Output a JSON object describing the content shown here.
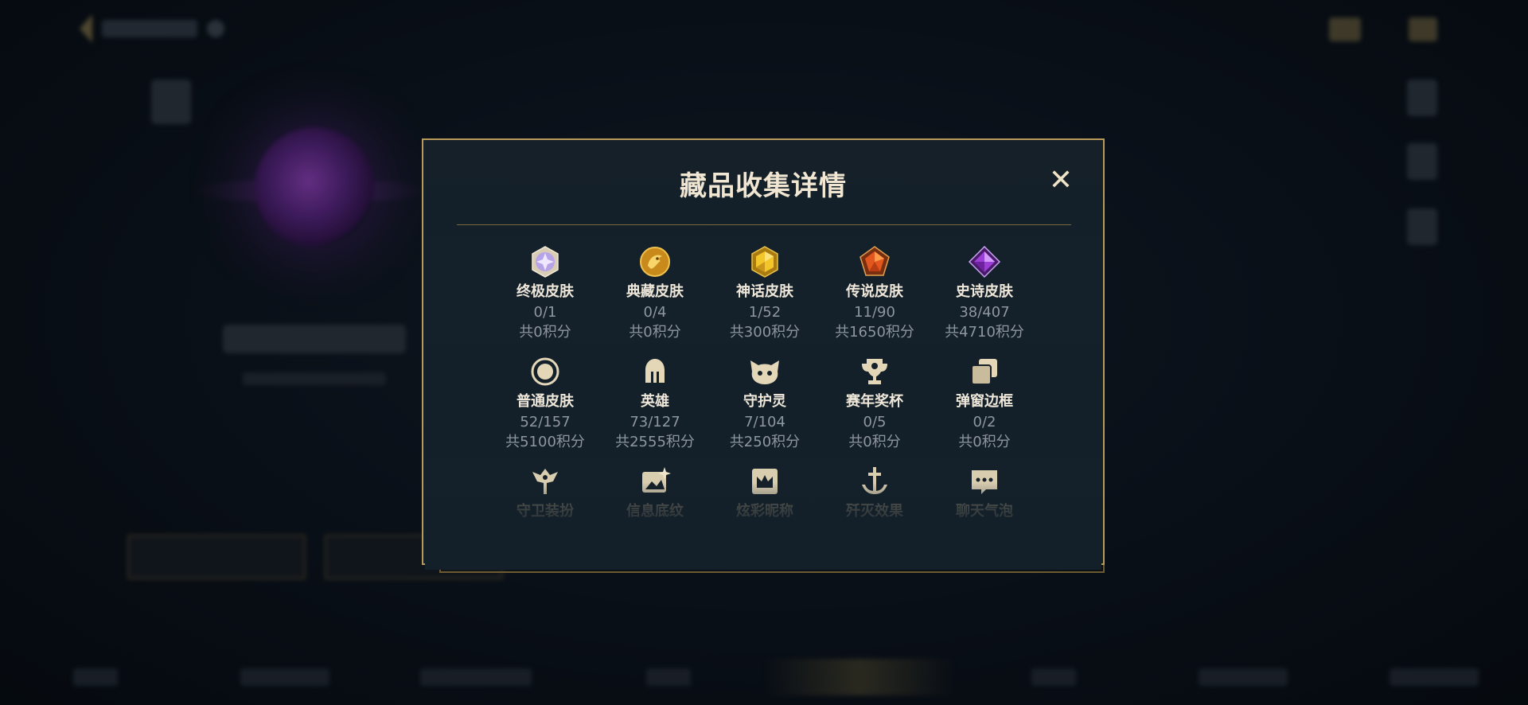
{
  "dialog": {
    "title": "藏品收集详情",
    "close_symbol": "✕"
  },
  "colors": {
    "accent_gold": "#b89b5a",
    "dialog_bg": "#152029",
    "title_text": "#f0e6d2",
    "secondary_text": "#8f969f"
  },
  "rows": [
    [
      {
        "label": "终极皮肤",
        "count": "0/1",
        "points": "共0积分",
        "icon": "ultimate-gem-icon"
      },
      {
        "label": "典藏皮肤",
        "count": "0/4",
        "points": "共0积分",
        "icon": "prestige-dragon-icon"
      },
      {
        "label": "神话皮肤",
        "count": "1/52",
        "points": "共300积分",
        "icon": "mythic-gem-icon"
      },
      {
        "label": "传说皮肤",
        "count": "11/90",
        "points": "共1650积分",
        "icon": "legendary-gem-icon"
      },
      {
        "label": "史诗皮肤",
        "count": "38/407",
        "points": "共4710积分",
        "icon": "epic-gem-icon"
      }
    ],
    [
      {
        "label": "普通皮肤",
        "count": "52/157",
        "points": "共5100积分",
        "icon": "ring-icon"
      },
      {
        "label": "英雄",
        "count": "73/127",
        "points": "共2555积分",
        "icon": "helmet-icon"
      },
      {
        "label": "守护灵",
        "count": "7/104",
        "points": "共250积分",
        "icon": "cat-face-icon"
      },
      {
        "label": "赛年奖杯",
        "count": "0/5",
        "points": "共0积分",
        "icon": "trophy-icon"
      },
      {
        "label": "弹窗边框",
        "count": "0/2",
        "points": "共0积分",
        "icon": "stacked-frames-icon"
      }
    ],
    [
      {
        "label": "守卫装扮",
        "icon": "ward-icon"
      },
      {
        "label": "信息底纹",
        "icon": "banner-sparkle-icon"
      },
      {
        "label": "炫彩昵称",
        "icon": "crown-card-icon"
      },
      {
        "label": "歼灭效果",
        "icon": "anchor-sword-icon"
      },
      {
        "label": "聊天气泡",
        "icon": "chat-bubble-icon"
      }
    ]
  ]
}
